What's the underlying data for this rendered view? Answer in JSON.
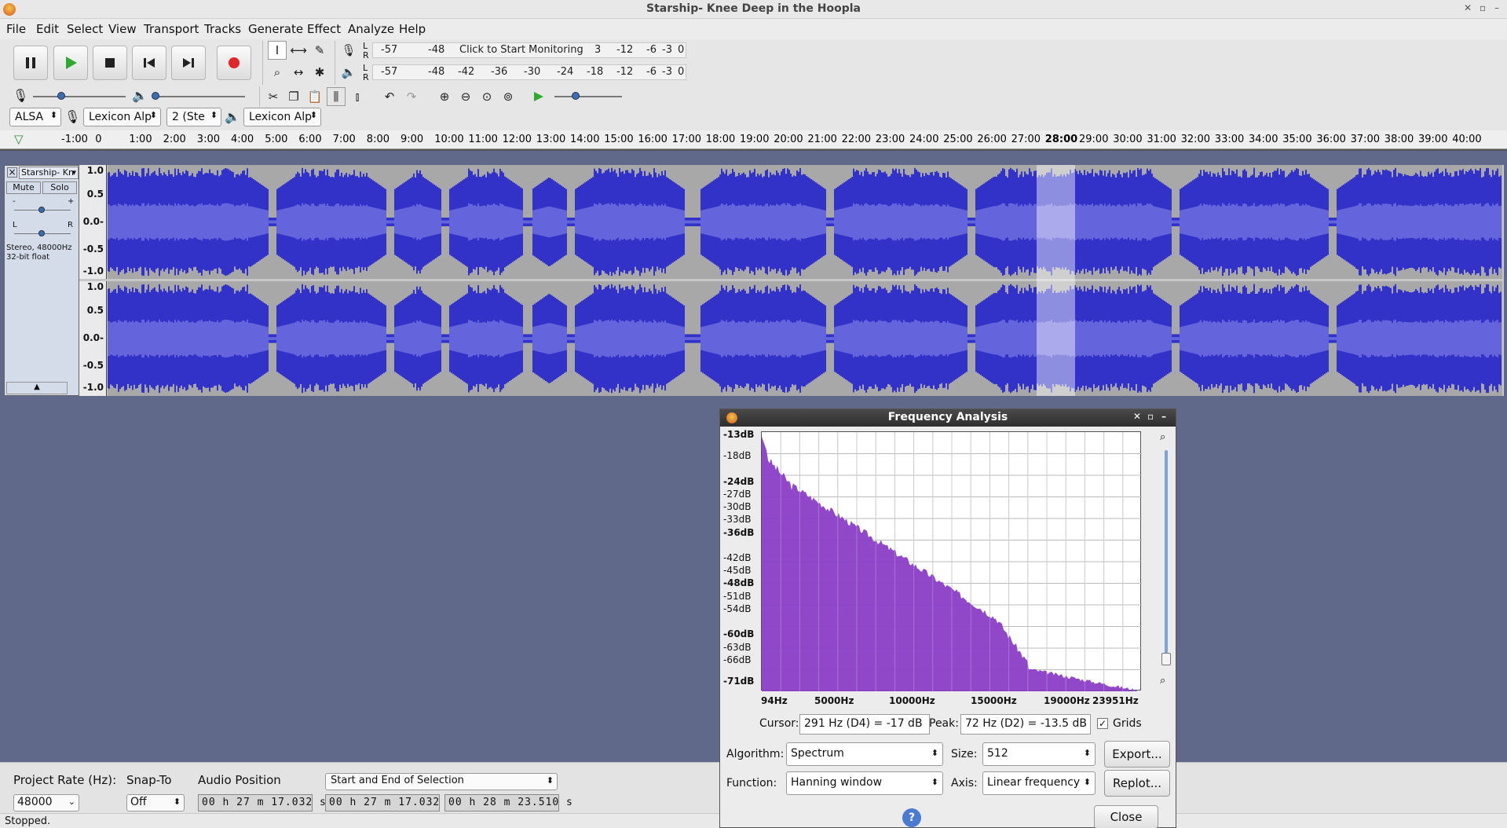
{
  "window": {
    "title": "Starship- Knee Deep in the Hoopla"
  },
  "menu": [
    "File",
    "Edit",
    "Select",
    "View",
    "Transport",
    "Tracks",
    "Generate",
    "Effect",
    "Analyze",
    "Help"
  ],
  "meters": {
    "record_ticks": [
      "-57",
      "-48"
    ],
    "record_prompt": "Click to Start Monitoring",
    "record_ticks_right": [
      "3",
      "-12",
      "-6",
      "-3",
      "0"
    ],
    "play_ticks": [
      "-57",
      "-48",
      "-42",
      "-36",
      "-30",
      "-24",
      "-18",
      "-12",
      "-6",
      "-3",
      "0"
    ],
    "lr": [
      "L",
      "R"
    ]
  },
  "device": {
    "host": "ALSA",
    "rec_device": "Lexicon Alp",
    "channels": "2 (Ste",
    "play_device": "Lexicon Alp"
  },
  "ruler": [
    "-1:00",
    "0",
    "1:00",
    "2:00",
    "3:00",
    "4:00",
    "5:00",
    "6:00",
    "7:00",
    "8:00",
    "9:00",
    "10:00",
    "11:00",
    "12:00",
    "13:00",
    "14:00",
    "15:00",
    "16:00",
    "17:00",
    "18:00",
    "19:00",
    "20:00",
    "21:00",
    "22:00",
    "23:00",
    "24:00",
    "25:00",
    "26:00",
    "27:00",
    "28:00",
    "29:00",
    "30:00",
    "31:00",
    "32:00",
    "33:00",
    "34:00",
    "35:00",
    "36:00",
    "37:00",
    "38:00",
    "39:00",
    "40:00"
  ],
  "track": {
    "name": "Starship- Kn",
    "mute": "Mute",
    "solo": "Solo",
    "gain_minus": "-",
    "gain_plus": "+",
    "pan_l": "L",
    "pan_r": "R",
    "info1": "Stereo, 48000Hz",
    "info2": "32-bit float",
    "close": "×"
  },
  "vruler": [
    "1.0",
    "0.5",
    "0.0-",
    "-0.5",
    "-1.0"
  ],
  "bottom": {
    "project_rate_label": "Project Rate (Hz):",
    "project_rate": "48000",
    "snap_label": "Snap-To",
    "snap": "Off",
    "audio_pos_label": "Audio Position",
    "audio_pos": "00 h 27 m 17.032 s",
    "selection_mode": "Start and End of Selection",
    "sel_start": "00 h 27 m 17.032 s",
    "sel_end": "00 h 28 m 23.510 s",
    "status": "Stopped."
  },
  "freq": {
    "title": "Frequency Analysis",
    "ylabels": [
      "-13dB",
      "-18dB",
      "-24dB",
      "-27dB",
      "-30dB",
      "-33dB",
      "-36dB",
      "-42dB",
      "-45dB",
      "-48dB",
      "-51dB",
      "-54dB",
      "-60dB",
      "-63dB",
      "-66dB",
      "-71dB"
    ],
    "xlabels": [
      "94Hz",
      "5000Hz",
      "10000Hz",
      "15000Hz",
      "19000Hz",
      "23951Hz"
    ],
    "cursor_label": "Cursor:",
    "cursor": "291 Hz (D4) = -17 dB",
    "peak_label": "Peak:",
    "peak": "72 Hz (D2) = -13.5 dB",
    "grids_label": "Grids",
    "algorithm_label": "Algorithm:",
    "algorithm": "Spectrum",
    "size_label": "Size:",
    "size": "512",
    "function_label": "Function:",
    "function": "Hanning window",
    "axis_label": "Axis:",
    "axis": "Linear frequency",
    "export": "Export...",
    "replot": "Replot...",
    "close": "Close",
    "help": "?"
  },
  "colors": {
    "wave": "#3232c8",
    "wave_rms": "#6464dc",
    "spectrum": "#8a3ec6",
    "background": "#61698a"
  }
}
